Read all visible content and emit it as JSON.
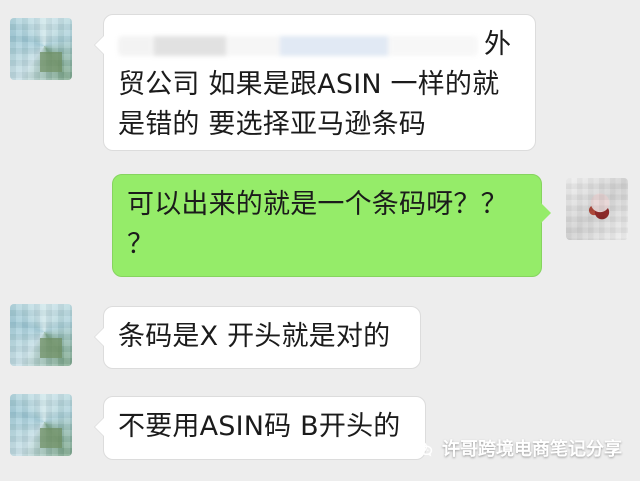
{
  "messages": [
    {
      "side": "left",
      "avatar_icon": "avatar-icon",
      "lines": [
        "外",
        "贸公司 如果是跟ASIN 一样的就",
        "是错的 要选择亚马逊条码"
      ]
    },
    {
      "side": "right",
      "avatar_icon": "avatar-icon",
      "lines": [
        "可以出来的就是一个条码呀？？",
        "？"
      ]
    },
    {
      "side": "left",
      "avatar_icon": "avatar-icon",
      "lines": [
        "条码是X 开头就是对的"
      ]
    },
    {
      "side": "left",
      "avatar_icon": "avatar-icon",
      "lines": [
        "不要用ASIN码 B开头的"
      ]
    }
  ],
  "watermark": {
    "icon": "wechat-icon",
    "text": "许哥跨境电商笔记分享"
  },
  "colors": {
    "background": "#ededed",
    "bubble_left": "#ffffff",
    "bubble_right": "#95ec69",
    "text": "#1b1b1b"
  }
}
